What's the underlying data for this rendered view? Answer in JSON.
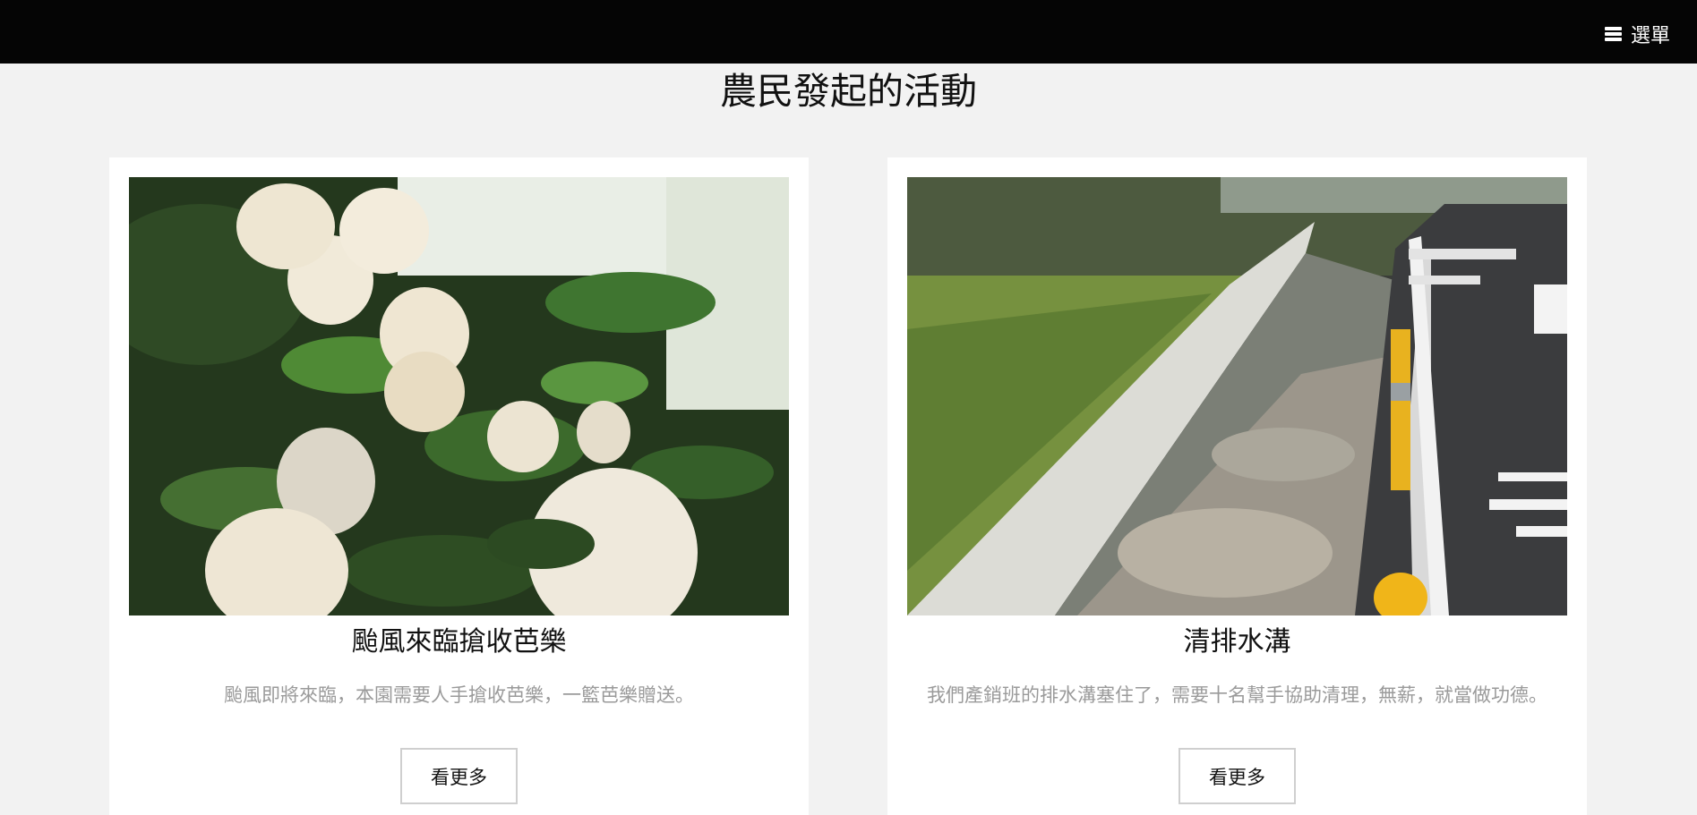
{
  "header": {
    "menu_icon": "hamburger-icon",
    "menu_label": "選單"
  },
  "section": {
    "title": "農民發起的活動"
  },
  "cards": [
    {
      "image": "pomelo-harvest-photo",
      "title": "颱風來臨搶收芭樂",
      "description": "颱風即將來臨，本園需要人手搶收芭樂，一籃芭樂贈送。",
      "button_label": "看更多"
    },
    {
      "image": "drainage-ditch-photo",
      "title": "清排水溝",
      "description": "我們產銷班的排水溝塞住了，需要十名幫手協助清理，無薪，就當做功德。",
      "button_label": "看更多"
    }
  ],
  "colors": {
    "header_bg": "#050505",
    "page_bg": "#f2f2f2",
    "card_bg": "#ffffff",
    "description_text": "#9a9a9a"
  }
}
